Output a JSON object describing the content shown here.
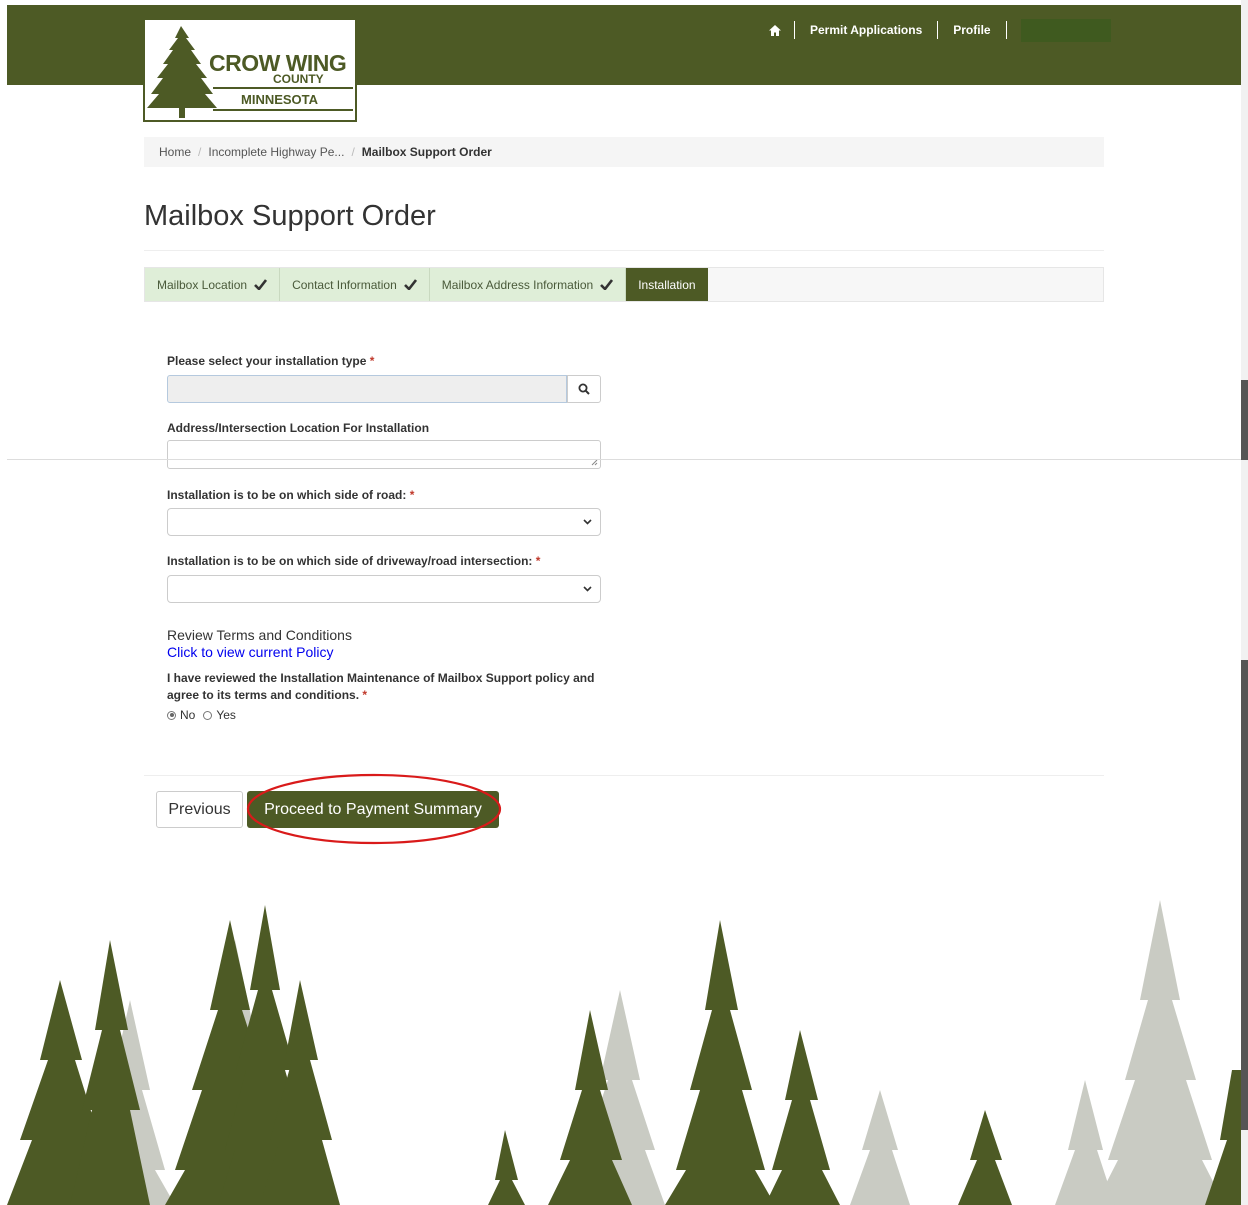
{
  "brand": {
    "logo_word1": "CROW WING",
    "logo_word2": "COUNTY",
    "logo_word3": "MINNESOTA",
    "header_color": "#4d5a25"
  },
  "topnav": {
    "home_icon": "home-icon",
    "permit_applications": "Permit Applications",
    "profile": "Profile"
  },
  "breadcrumb": {
    "home": "Home",
    "incomplete": "Incomplete Highway Pe...",
    "current": "Mailbox Support Order",
    "separator": "/"
  },
  "page": {
    "title": "Mailbox Support Order"
  },
  "steps": [
    {
      "label": "Mailbox Location",
      "done": true
    },
    {
      "label": "Contact Information",
      "done": true
    },
    {
      "label": "Mailbox Address Information",
      "done": true
    },
    {
      "label": "Installation",
      "done": false
    }
  ],
  "form": {
    "installation_type_label": "Please select your installation type",
    "installation_type_value": "",
    "address_label": "Address/Intersection Location For Installation",
    "address_value": "",
    "side_of_road_label": "Installation is to be on which side of road:",
    "side_of_road_value": "",
    "side_of_intersection_label": "Installation is to be on which side of driveway/road intersection:",
    "side_of_intersection_value": "",
    "required_marker": "*",
    "terms_heading": "Review Terms and Conditions",
    "policy_link": "Click to view current Policy",
    "agree_label": "I have reviewed the Installation Maintenance of Mailbox Support policy and agree to its terms and conditions.",
    "radio_no": "No",
    "radio_yes": "Yes",
    "selected": "No"
  },
  "actions": {
    "previous": "Previous",
    "proceed": "Proceed to Payment Summary",
    "highlight_color": "#d91a1a"
  }
}
